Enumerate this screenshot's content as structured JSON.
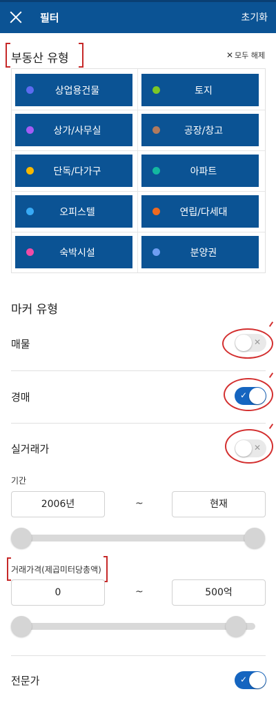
{
  "header": {
    "title": "필터",
    "reset_label": "초기화"
  },
  "property_type": {
    "title": "부동산 유형",
    "clear_all": "모두 해제",
    "items": [
      {
        "label": "상업용건물",
        "color": "#5c6bf0"
      },
      {
        "label": "토지",
        "color": "#7cc727"
      },
      {
        "label": "상가/사무실",
        "color": "#a35cf5"
      },
      {
        "label": "공장/창고",
        "color": "#b07a5e"
      },
      {
        "label": "단독/다가구",
        "color": "#f6b800"
      },
      {
        "label": "아파트",
        "color": "#13b8a0"
      },
      {
        "label": "오피스텔",
        "color": "#38aaf5"
      },
      {
        "label": "연립/다세대",
        "color": "#ef6a20"
      },
      {
        "label": "숙박시설",
        "color": "#f04ba6"
      },
      {
        "label": "분양권",
        "color": "#6f9ef2"
      }
    ]
  },
  "marker_type": {
    "title": "마커 유형",
    "listing": {
      "label": "매물",
      "on": false
    },
    "auction": {
      "label": "경매",
      "on": true
    },
    "actual_price": {
      "label": "실거래가",
      "on": false
    }
  },
  "period": {
    "label": "기간",
    "from": "2006년",
    "to": "현재",
    "separator": "~",
    "from_fraction": 0.0,
    "to_fraction": 1.0
  },
  "price": {
    "label": "거래가격(제곱미터당총액)",
    "from": "0",
    "to": "500억",
    "separator": "~",
    "from_fraction": 0.0,
    "to_fraction": 0.92
  },
  "expert": {
    "label": "전문가",
    "on": true
  }
}
